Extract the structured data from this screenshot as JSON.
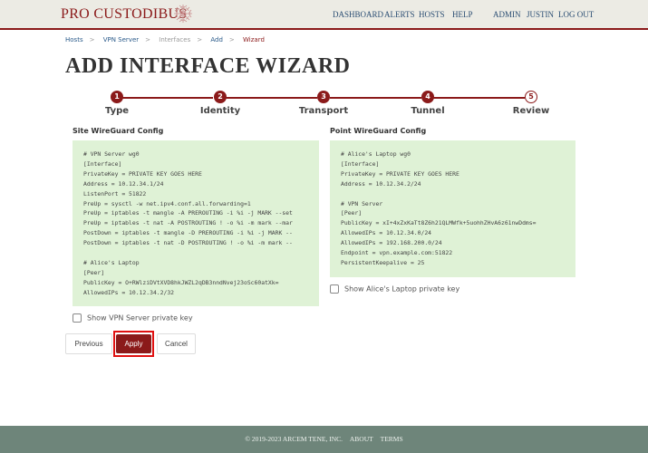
{
  "header": {
    "brand": "PRO CUSTODIBUS",
    "logo_icon": "ornamental-emblem-icon",
    "nav": [
      "DASHBOARD",
      "ALERTS",
      "HOSTS",
      "HELP"
    ],
    "user_nav": [
      "ADMIN",
      "JUSTIN",
      "LOG OUT"
    ]
  },
  "breadcrumb": [
    {
      "label": "Hosts",
      "style": "link"
    },
    {
      "label": "VPN Server",
      "style": "link"
    },
    {
      "label": "Interfaces",
      "style": "plain"
    },
    {
      "label": "Add",
      "style": "link"
    },
    {
      "label": "Wizard",
      "style": "current"
    }
  ],
  "breadcrumb_separator": ">",
  "page_title": "ADD INTERFACE WIZARD",
  "wizard": {
    "steps": [
      {
        "number": "1",
        "label": "Type",
        "state": "complete"
      },
      {
        "number": "2",
        "label": "Identity",
        "state": "complete"
      },
      {
        "number": "3",
        "label": "Transport",
        "state": "complete"
      },
      {
        "number": "4",
        "label": "Tunnel",
        "state": "complete"
      },
      {
        "number": "5",
        "label": "Review",
        "state": "current"
      }
    ]
  },
  "site_config": {
    "heading": "Site WireGuard Config",
    "text": "# VPN Server wg0\n[Interface]\nPrivateKey = PRIVATE KEY GOES HERE\nAddress = 10.12.34.1/24\nListenPort = 51822\nPreUp = sysctl -w net.ipv4.conf.all.forwarding=1\nPreUp = iptables -t mangle -A PREROUTING -i %i -j MARK --set\nPreUp = iptables -t nat -A POSTROUTING ! -o %i -m mark --mar\nPostDown = iptables -t mangle -D PREROUTING -i %i -j MARK --\nPostDown = iptables -t nat -D POSTROUTING ! -o %i -m mark --\n\n# Alice's Laptop\n[Peer]\nPublicKey = O+RWlziDVtXVD8hkJWZL2qDB3nndNvej23oSc60atXk=\nAllowedIPs = 10.12.34.2/32",
    "checkbox_label": "Show VPN Server private key",
    "checked": false
  },
  "point_config": {
    "heading": "Point WireGuard Config",
    "text": "# Alice's Laptop wg0\n[Interface]\nPrivateKey = PRIVATE KEY GOES HERE\nAddress = 10.12.34.2/24\n\n# VPN Server\n[Peer]\nPublicKey = xI+4xZxKaTt8Z6h21QLMWfk+5uohhZHvA6z61nwDdms=\nAllowedIPs = 10.12.34.0/24\nAllowedIPs = 192.168.200.0/24\nEndpoint = vpn.example.com:51822\nPersistentKeepalive = 25",
    "checkbox_label": "Show Alice's Laptop private key",
    "checked": false
  },
  "actions": {
    "previous": "Previous",
    "apply": "Apply",
    "cancel": "Cancel"
  },
  "footer": {
    "copyright": "© 2019-2023 ARCEM TENE, INC.",
    "links": [
      "ABOUT",
      "TERMS"
    ]
  },
  "colors": {
    "brand": "#8b1a1a",
    "header_bg": "#ecebe4",
    "nav_text": "#2a4d73",
    "code_bg": "#dff2d6",
    "footer_bg": "#6e857a",
    "highlight_outline": "#e01010"
  }
}
